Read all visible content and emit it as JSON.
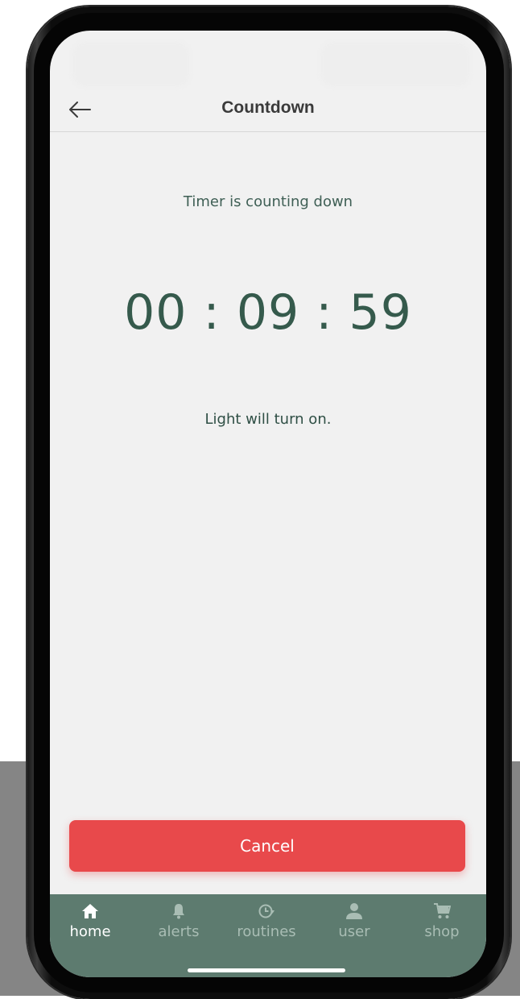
{
  "header": {
    "title": "Countdown"
  },
  "countdown": {
    "status_text": "Timer is counting down",
    "time_display": "00 : 09 : 59",
    "action_text": "Light will turn on."
  },
  "cancel_button": {
    "label": "Cancel"
  },
  "tabs": [
    {
      "label": "home",
      "icon": "home-icon",
      "active": true
    },
    {
      "label": "alerts",
      "icon": "bell-icon",
      "active": false
    },
    {
      "label": "routines",
      "icon": "clock-refresh-icon",
      "active": false
    },
    {
      "label": "user",
      "icon": "user-icon",
      "active": false
    },
    {
      "label": "shop",
      "icon": "cart-icon",
      "active": false
    }
  ],
  "colors": {
    "accent_green": "#355a4c",
    "tabbar_bg": "#5d7b6f",
    "cancel_red": "#e8494b",
    "screen_bg": "#f1f1f1"
  }
}
